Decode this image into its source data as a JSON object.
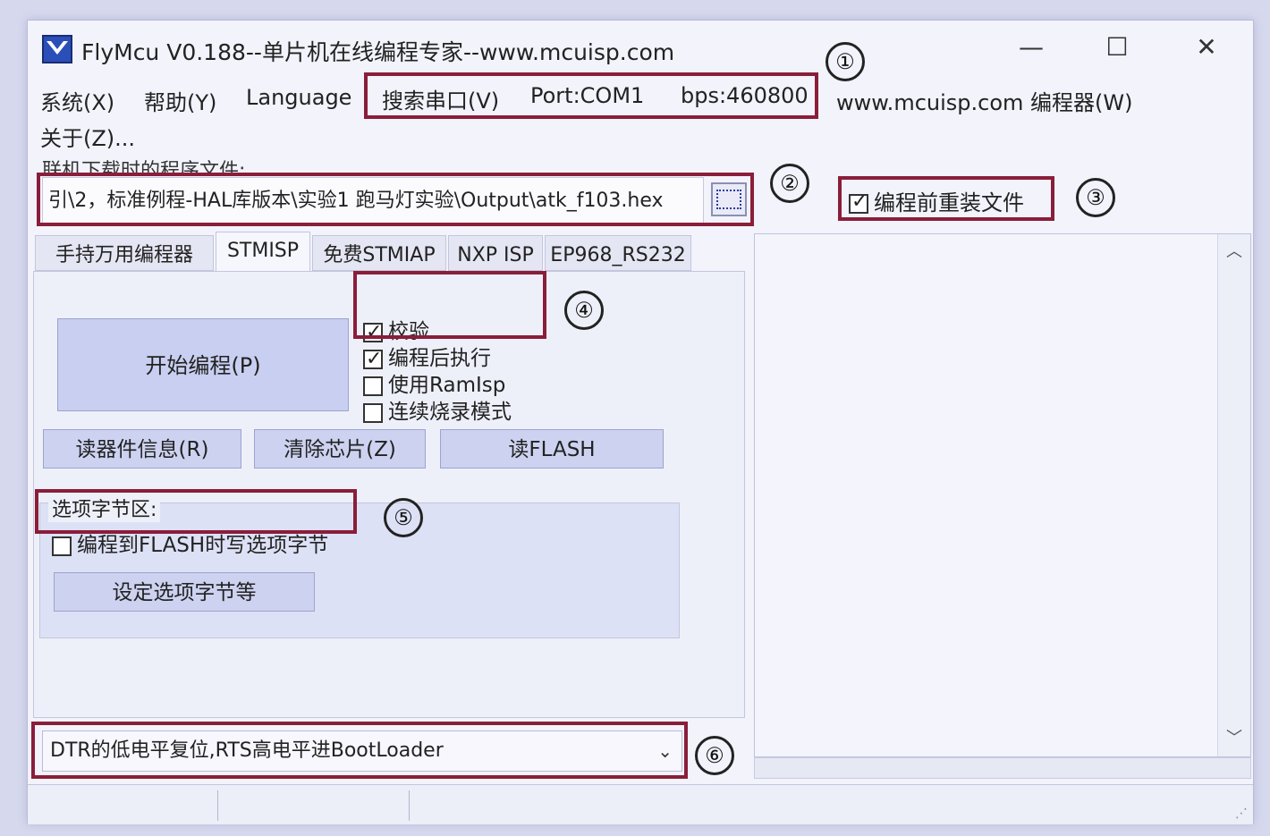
{
  "window": {
    "title": "FlyMcu V0.188--单片机在线编程专家--www.mcuisp.com",
    "minimize": "—",
    "maximize": "☐",
    "close": "✕"
  },
  "menu": {
    "system": "系统(X)",
    "help": "帮助(Y)",
    "language": "Language",
    "search_port": "搜索串口(V)",
    "port": "Port:COM1",
    "bps": "bps:460800",
    "programmer": "www.mcuisp.com 编程器(W)",
    "about": "关于(Z)..."
  },
  "file": {
    "label": "联机下载时的程序文件:",
    "path": "引\\2，标准例程-HAL库版本\\实验1 跑马灯实验\\Output\\atk_f103.hex",
    "reload_label": "编程前重装文件",
    "reload_checked": true
  },
  "tabs": [
    "手持万用编程器",
    "STMISP",
    "免费STMIAP",
    "NXP ISP",
    "EP968_RS232"
  ],
  "stmisp": {
    "start_button": "开始编程(P)",
    "options": [
      {
        "label": "校验",
        "checked": true
      },
      {
        "label": "编程后执行",
        "checked": true
      },
      {
        "label": "使用RamIsp",
        "checked": false
      },
      {
        "label": "连续烧录模式",
        "checked": false
      }
    ],
    "read_info_button": "读器件信息(R)",
    "erase_button": "清除芯片(Z)",
    "read_flash_button": "读FLASH",
    "option_bytes_label": "选项字节区:",
    "write_option_label": "编程到FLASH时写选项字节",
    "write_option_checked": false,
    "set_option_button": "设定选项字节等",
    "reset_mode": "DTR的低电平复位,RTS高电平进BootLoader"
  },
  "callouts": [
    "①",
    "②",
    "③",
    "④",
    "⑤",
    "⑥"
  ],
  "colors": {
    "highlight": "#8a1e3a",
    "button": "#cdd2f0",
    "background": "#f2f3fb"
  }
}
